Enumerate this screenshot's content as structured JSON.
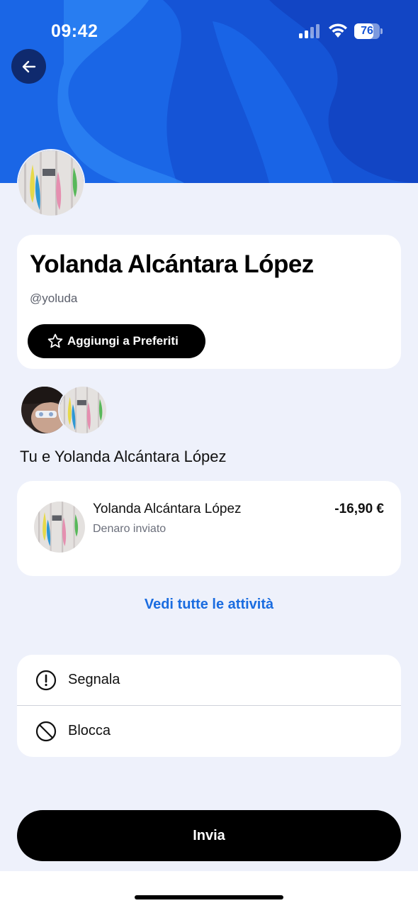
{
  "status_bar": {
    "time": "09:42",
    "battery": "76",
    "battery_level_percent": 76,
    "icons": [
      "signal-icon",
      "wifi-icon",
      "battery-icon"
    ]
  },
  "header": {
    "back_icon": "arrow-left-icon",
    "colors": {
      "hero_blue": "#1554d6",
      "hero_light": "#1f78ee",
      "back_button": "#0f2a6e"
    }
  },
  "profile": {
    "name": "Yolanda Alcántara López",
    "handle": "@yoluda",
    "favorite_label": "Aggiungi a Preferiti",
    "favorite_icon": "star-outline-icon"
  },
  "relationship": {
    "title": "Tu e Yolanda Alcántara López"
  },
  "transaction": {
    "name": "Yolanda Alcántara López",
    "description": "Denaro inviato",
    "amount": "-16,90 €"
  },
  "see_all_label": "Vedi tutte le attività",
  "actions": [
    {
      "label": "Segnala",
      "icon": "alert-circle-icon"
    },
    {
      "label": "Blocca",
      "icon": "block-icon"
    }
  ],
  "send_label": "Invia",
  "colors": {
    "page_bg": "#eef1fb",
    "link_blue": "#1a6ce0",
    "button_black": "#000000"
  }
}
